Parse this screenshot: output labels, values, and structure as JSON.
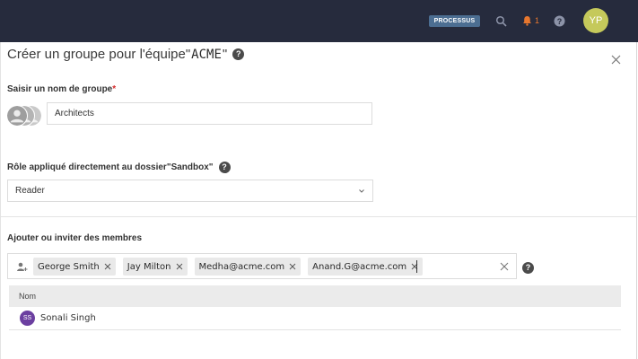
{
  "header": {
    "process_badge": "PROCESSUS",
    "notification_count": "1",
    "user_initials": "YP"
  },
  "dialog": {
    "title_prefix": "Créer un groupe pour l'équipe",
    "title_open_quote": "\"",
    "team_name": "ACME",
    "title_close_quote": " \"",
    "group_name_label": "Saisir un nom de groupe",
    "group_name_required_marker": "*",
    "group_name_value": "Architects",
    "role_label": "Rôle appliqué directement au dossier\"Sandbox\"",
    "role_value": "Reader",
    "members_label": "Ajouter ou inviter des membres",
    "member_chips": [
      {
        "label": "George Smith"
      },
      {
        "label": "Jay Milton"
      },
      {
        "label": "Medha@acme.com"
      },
      {
        "label": "Anand.G@acme.com"
      }
    ],
    "table": {
      "column_name": "Nom",
      "rows": [
        {
          "initials": "SS",
          "name": "Sonali Singh"
        }
      ]
    }
  },
  "colors": {
    "topbar": "#262b3d",
    "badge": "#4c6e92",
    "avatar": "#c5c95b",
    "bell": "#e8772e",
    "required": "#d42a2a",
    "user_avatar": "#6b3fa0"
  },
  "icons": [
    "search-icon",
    "bell-icon",
    "help-icon",
    "close-icon",
    "chevron-down-icon",
    "person-icon",
    "remove-chip-icon",
    "clear-icon"
  ]
}
